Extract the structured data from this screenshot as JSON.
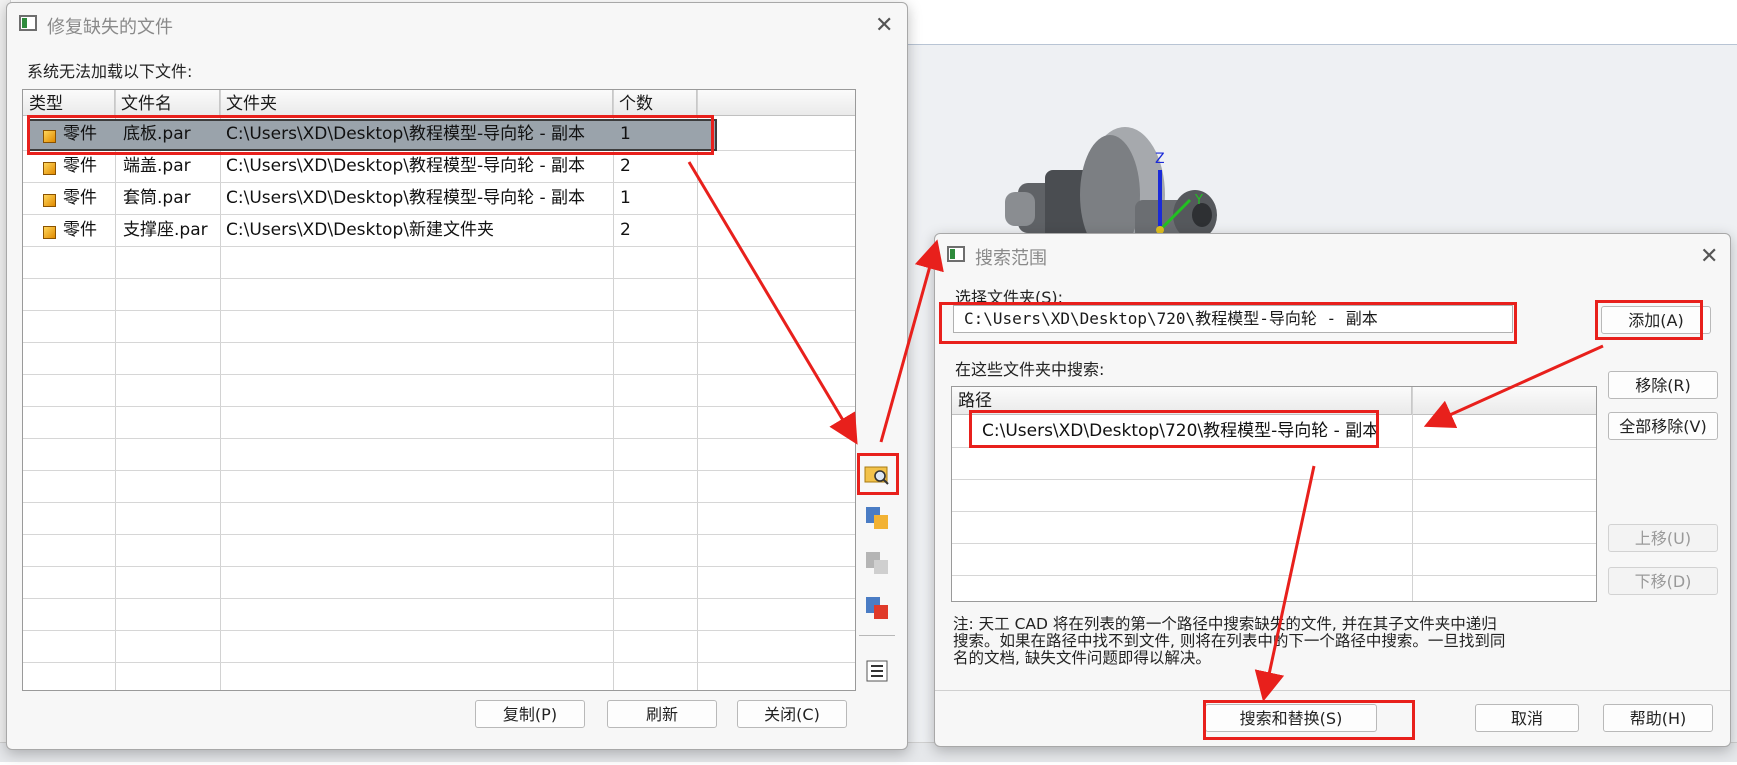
{
  "left_dialog": {
    "title": "修复缺失的文件",
    "prompt": "系统无法加载以下文件:",
    "columns": [
      "类型",
      "文件名",
      "文件夹",
      "个数"
    ],
    "rows": [
      {
        "type": "零件",
        "filename": "底板.par",
        "folder": "C:\\Users\\XD\\Desktop\\教程模型-导向轮 - 副本",
        "count": "1"
      },
      {
        "type": "零件",
        "filename": "端盖.par",
        "folder": "C:\\Users\\XD\\Desktop\\教程模型-导向轮 - 副本",
        "count": "2"
      },
      {
        "type": "零件",
        "filename": "套筒.par",
        "folder": "C:\\Users\\XD\\Desktop\\教程模型-导向轮 - 副本",
        "count": "1"
      },
      {
        "type": "零件",
        "filename": "支撑座.par",
        "folder": "C:\\Users\\XD\\Desktop\\新建文件夹",
        "count": "2"
      }
    ],
    "buttons": {
      "copy": "复制(P)",
      "refresh": "刷新",
      "close": "关闭(C)"
    }
  },
  "right_dialog": {
    "title": "搜索范围",
    "select_folder_label": "选择文件夹(S):",
    "select_folder_value": "C:\\Users\\XD\\Desktop\\720\\教程模型-导向轮 - 副本",
    "search_in_label": "在这些文件夹中搜索:",
    "path_column": "路径",
    "paths": [
      "C:\\Users\\XD\\Desktop\\720\\教程模型-导向轮 - 副本"
    ],
    "buttons": {
      "add": "添加(A)",
      "remove": "移除(R)",
      "remove_all": "全部移除(V)",
      "move_up": "上移(U)",
      "move_down": "下移(D)",
      "search_replace": "搜索和替换(S)",
      "cancel": "取消",
      "help": "帮助(H)"
    },
    "note_lines": [
      "注: 天工 CAD 将在列表的第一个路径中搜索缺失的文件, 并在其子文件夹中递归",
      "搜索。如果在路径中找不到文件, 则将在列表中的下一个路径中搜索。一旦找到同",
      "名的文档, 缺失文件问题即得以解决。"
    ]
  },
  "colors": {
    "highlight": "#e8201c",
    "selection": "#9aa3ab"
  }
}
